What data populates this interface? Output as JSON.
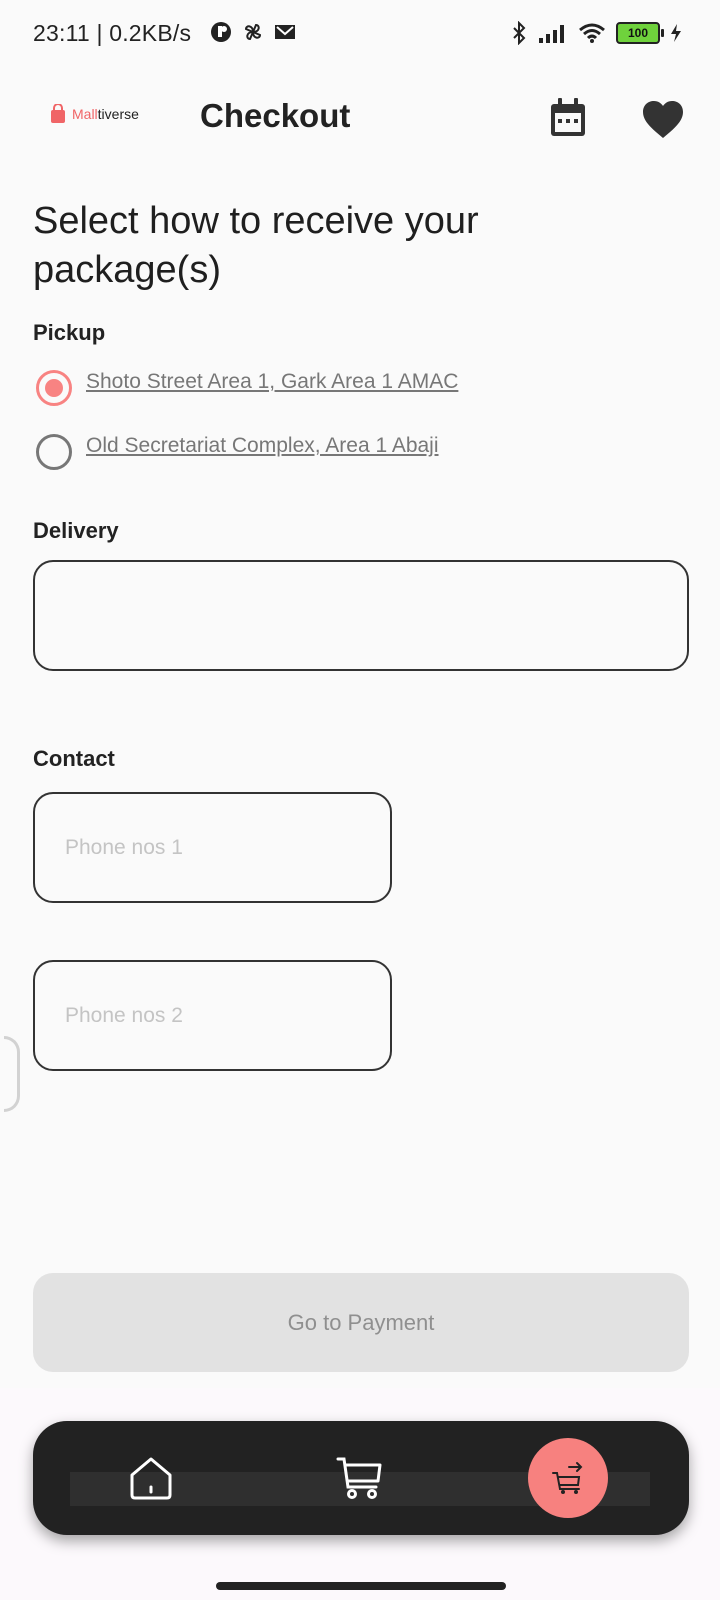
{
  "status_bar": {
    "time_speed": "23:11 | 0.2KB/s",
    "battery": "100"
  },
  "header": {
    "logo_part1": "Mall",
    "logo_part2": "tiverse",
    "title": "Checkout"
  },
  "main": {
    "heading": "Select how to receive your package(s)",
    "pickup": {
      "label": "Pickup",
      "options": [
        {
          "label": "Shoto Street Area 1, Gark Area 1 AMAC",
          "selected": true
        },
        {
          "label": "Old Secretariat Complex, Area 1 Abaji",
          "selected": false
        }
      ]
    },
    "delivery": {
      "label": "Delivery",
      "value": ""
    },
    "contact": {
      "label": "Contact",
      "phone1_placeholder": "Phone nos 1",
      "phone2_placeholder": "Phone nos 2"
    },
    "go_to_payment": "Go to Payment"
  },
  "colors": {
    "accent": "#f7817f",
    "nav_background": "#222222",
    "disabled_button": "#e2e2e2"
  },
  "bottom_nav": {
    "items": [
      "home-icon",
      "cart-icon",
      "checkout-cart-icon"
    ],
    "active": "checkout-cart-icon"
  }
}
